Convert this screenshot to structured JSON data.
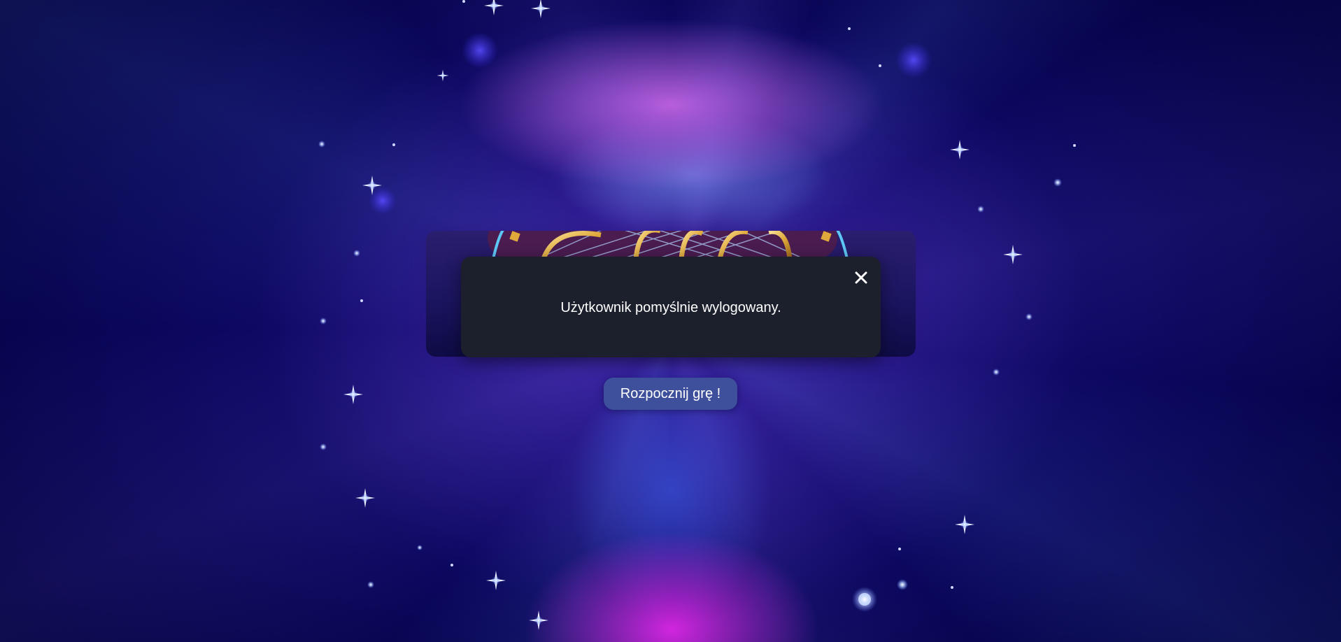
{
  "modal": {
    "message": "Użytkownik pomyślnie wylogowany.",
    "close_icon": "close-icon"
  },
  "actions": {
    "start_label": "Rozpocznij grę !"
  },
  "logo": {
    "icon": "game-logo"
  },
  "colors": {
    "modal_bg": "#1c1f2c",
    "button_bg": "#3e4f9c",
    "logo_gold": "#e8b64a",
    "logo_ring": "#5ec8f5"
  }
}
